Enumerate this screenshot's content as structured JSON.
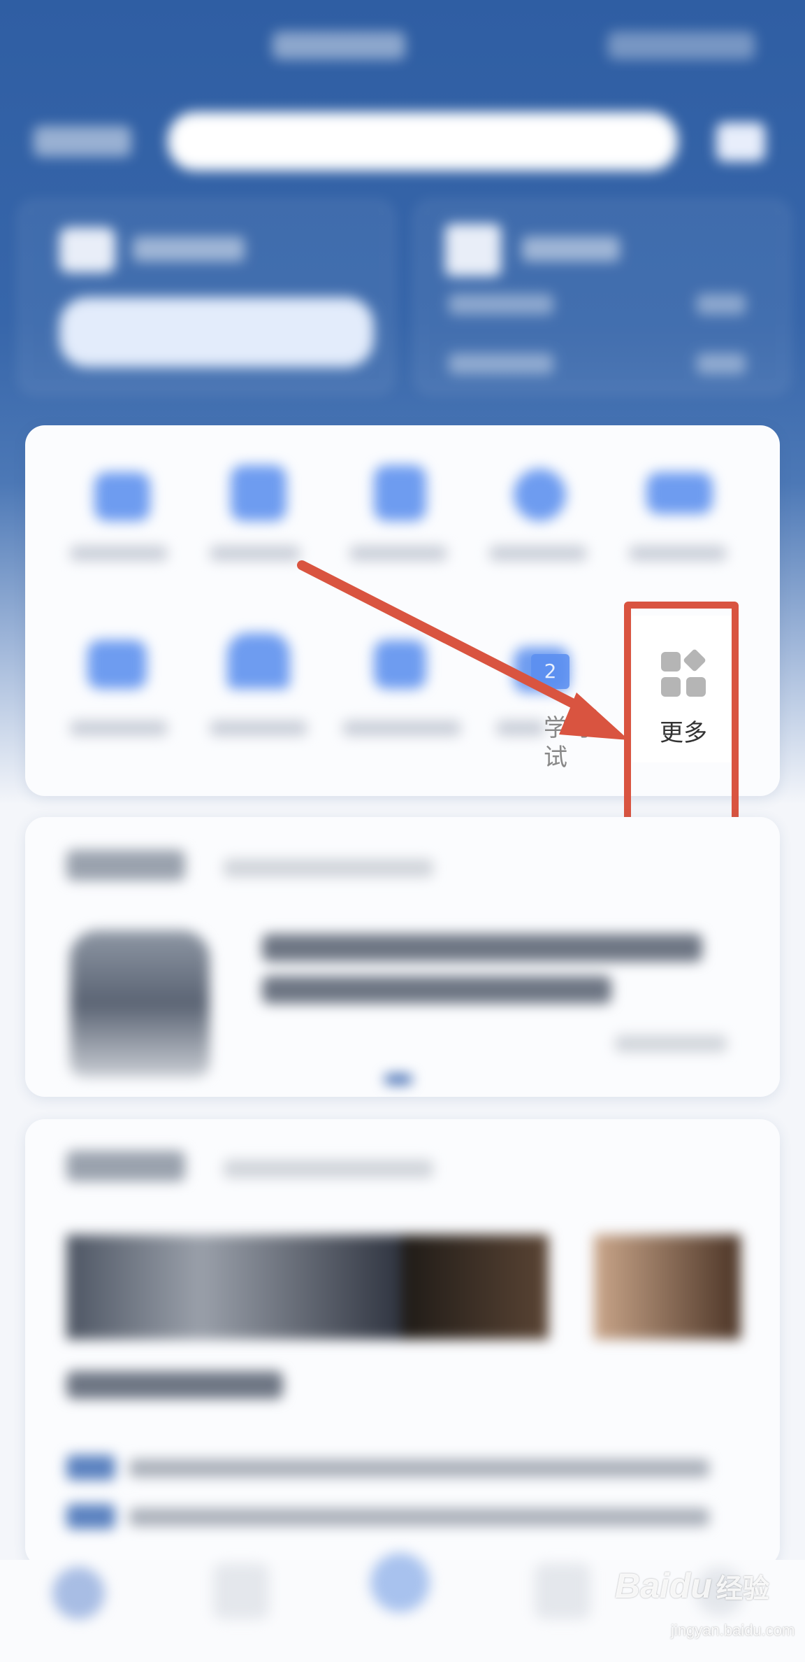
{
  "quick_actions": {
    "partial_label": "学习\n试",
    "partial_badge": "2",
    "more_label": "更多"
  },
  "watermark": {
    "brand": "Baidu",
    "brand_cn": "经验",
    "url": "jingyan.baidu.com"
  },
  "colors": {
    "header_blue": "#2f5ea3",
    "icon_blue": "#6e9cf0",
    "highlight_red": "#d95440"
  }
}
